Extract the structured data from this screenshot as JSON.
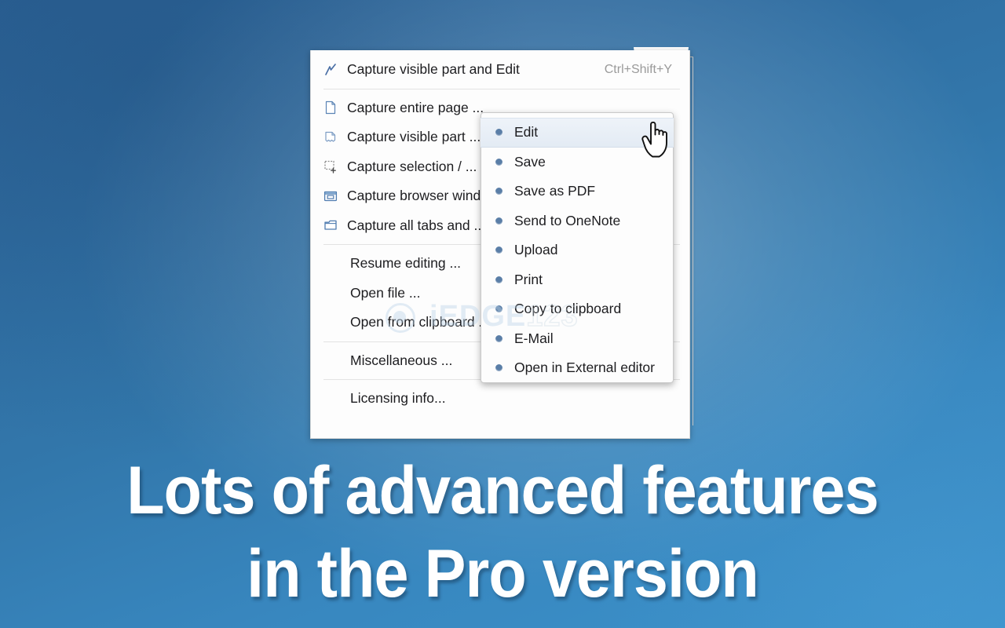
{
  "background": {
    "color_top_left": "#2c6296",
    "color_bottom_right": "#3b92cb",
    "accent": "#5a7ea7"
  },
  "menu": {
    "top_group": [
      {
        "label": "Capture visible part and Edit",
        "shortcut": "Ctrl+Shift+Y",
        "icon": "lightning-edit-icon"
      }
    ],
    "capture_group": [
      {
        "label": "Capture entire page ...",
        "icon": "page-icon"
      },
      {
        "label": "Capture visible part ...",
        "icon": "torn-page-icon"
      },
      {
        "label": "Capture selection / ...",
        "icon": "selection-plus-icon"
      },
      {
        "label": "Capture browser window ...",
        "icon": "browser-window-icon"
      },
      {
        "label": "Capture all tabs and ...",
        "icon": "tabs-icon"
      }
    ],
    "open_group": [
      {
        "label": "Resume editing ..."
      },
      {
        "label": "Open file ..."
      },
      {
        "label": "Open from clipboard ..."
      }
    ],
    "misc_group": [
      {
        "label": "Miscellaneous ..."
      }
    ],
    "licensing_group": [
      {
        "label": "Licensing info..."
      }
    ]
  },
  "submenu": {
    "items": [
      {
        "label": "Edit",
        "selected": true
      },
      {
        "label": "Save",
        "selected": false
      },
      {
        "label": "Save as PDF",
        "selected": false
      },
      {
        "label": "Send to OneNote",
        "selected": false
      },
      {
        "label": "Upload",
        "selected": false
      },
      {
        "label": "Print",
        "selected": false
      },
      {
        "label": "Copy to clipboard",
        "selected": false
      },
      {
        "label": "E-Mail",
        "selected": false
      },
      {
        "label": "Open in External editor",
        "selected": false
      }
    ]
  },
  "watermark": {
    "part_i": "i",
    "part_edge": "EDGE",
    "part_123": "123"
  },
  "caption": {
    "line1": "Lots of advanced features",
    "line2": "in the Pro version"
  }
}
